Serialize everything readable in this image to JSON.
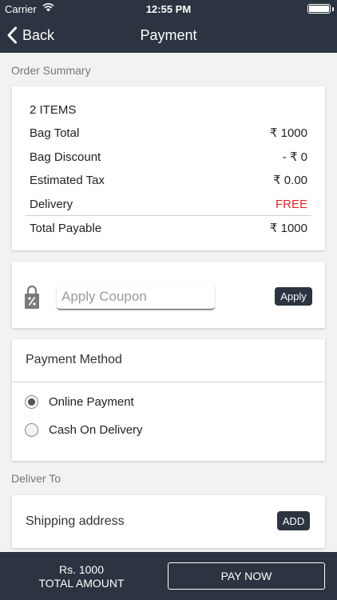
{
  "status_bar": {
    "carrier": "Carrier",
    "time": "12:55 PM"
  },
  "nav": {
    "back_label": "Back",
    "title": "Payment"
  },
  "order_summary": {
    "section_label": "Order Summary",
    "items_count": "2 ITEMS",
    "rows": [
      {
        "label": "Bag Total",
        "value": "₹ 1000"
      },
      {
        "label": "Bag Discount",
        "value": "- ₹ 0"
      },
      {
        "label": "Estimated Tax",
        "value": "₹ 0.00"
      },
      {
        "label": "Delivery",
        "value": "FREE"
      }
    ],
    "total": {
      "label": "Total Payable",
      "value": "₹ 1000"
    }
  },
  "coupon": {
    "placeholder": "Apply Coupon",
    "value": "",
    "button_label": "Apply"
  },
  "payment_method": {
    "title": "Payment Method",
    "options": [
      {
        "label": "Online Payment",
        "selected": true
      },
      {
        "label": "Cash On Delivery",
        "selected": false
      }
    ]
  },
  "deliver_to": {
    "section_label": "Deliver To",
    "shipping_label": "Shipping address",
    "add_button_label": "ADD"
  },
  "bottom_bar": {
    "amount": "Rs. 1000",
    "amount_caption": "TOTAL AMOUNT",
    "pay_button_label": "PAY NOW"
  },
  "colors": {
    "header_bg": "#2b3440",
    "page_bg": "#f2f2f2",
    "free_text": "#e02424"
  },
  "icons": {
    "back": "chevron-left-icon",
    "coupon": "discount-lock-icon",
    "wifi": "wifi-icon",
    "battery": "battery-icon"
  }
}
